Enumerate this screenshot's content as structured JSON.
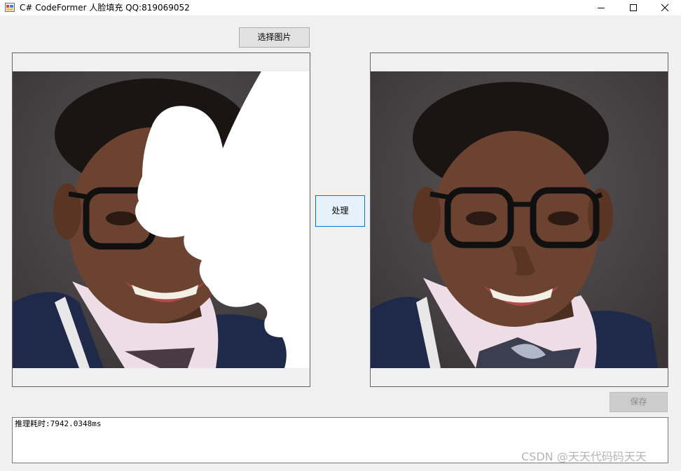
{
  "window": {
    "title": "C# CodeFormer 人脸填充 QQ:819069052",
    "icon": "app-icon",
    "controls": [
      "minimize-icon",
      "maximize-icon",
      "close-icon"
    ]
  },
  "buttons": {
    "select_image": "选择图片",
    "process": "处理",
    "save": "保存"
  },
  "images": {
    "input": "person-photo-with-white-mask",
    "output": "person-photo-restored"
  },
  "output": {
    "text": "推理耗时:7942.0348ms"
  },
  "watermark": {
    "text": "CSDN @天天代码码天天"
  },
  "colors": {
    "background": "#f0f0f0",
    "focus_border": "#0078d7",
    "button_face": "#e1e1e1"
  }
}
